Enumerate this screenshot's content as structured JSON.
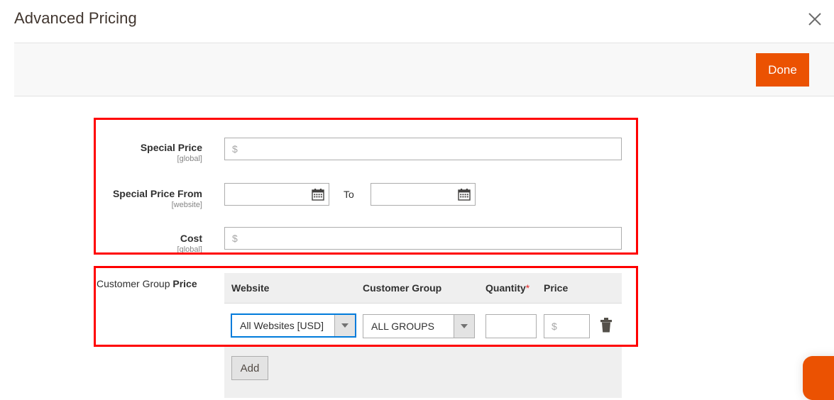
{
  "modal": {
    "title": "Advanced Pricing",
    "close_icon": "close-icon",
    "done_label": "Done"
  },
  "form": {
    "fields": [
      {
        "label": "Special Price",
        "scope": "[global]",
        "type": "price",
        "value": "",
        "placeholder": "$"
      },
      {
        "label": "Special Price From",
        "scope": "[website]",
        "type": "date-range",
        "from_value": "",
        "from_placeholder": "",
        "separator_label": "To",
        "to_value": "",
        "to_placeholder": "",
        "calendar_icon": "calendar-icon"
      },
      {
        "label": "Cost",
        "scope": "[global]",
        "type": "price",
        "value": "",
        "placeholder": "$"
      }
    ]
  },
  "customer_group_price": {
    "label_regular": "Customer Group ",
    "label_bold": "Price",
    "columns": [
      {
        "label": "Website",
        "required": false
      },
      {
        "label": "Customer Group",
        "required": false
      },
      {
        "label": "Quantity",
        "required": true,
        "required_marker": "*"
      },
      {
        "label": "Price",
        "required": false
      }
    ],
    "rows": [
      {
        "website": "All Websites [USD]",
        "website_focused": true,
        "customer_group": "ALL GROUPS",
        "quantity": "",
        "quantity_placeholder": "",
        "price": "",
        "price_placeholder": "$",
        "delete_icon": "trash-icon"
      }
    ],
    "add_label": "Add"
  },
  "colors": {
    "accent_orange": "#eb5202",
    "highlight_red": "#ff0000",
    "focus_blue": "#007bdb",
    "required_red": "#e22626"
  }
}
